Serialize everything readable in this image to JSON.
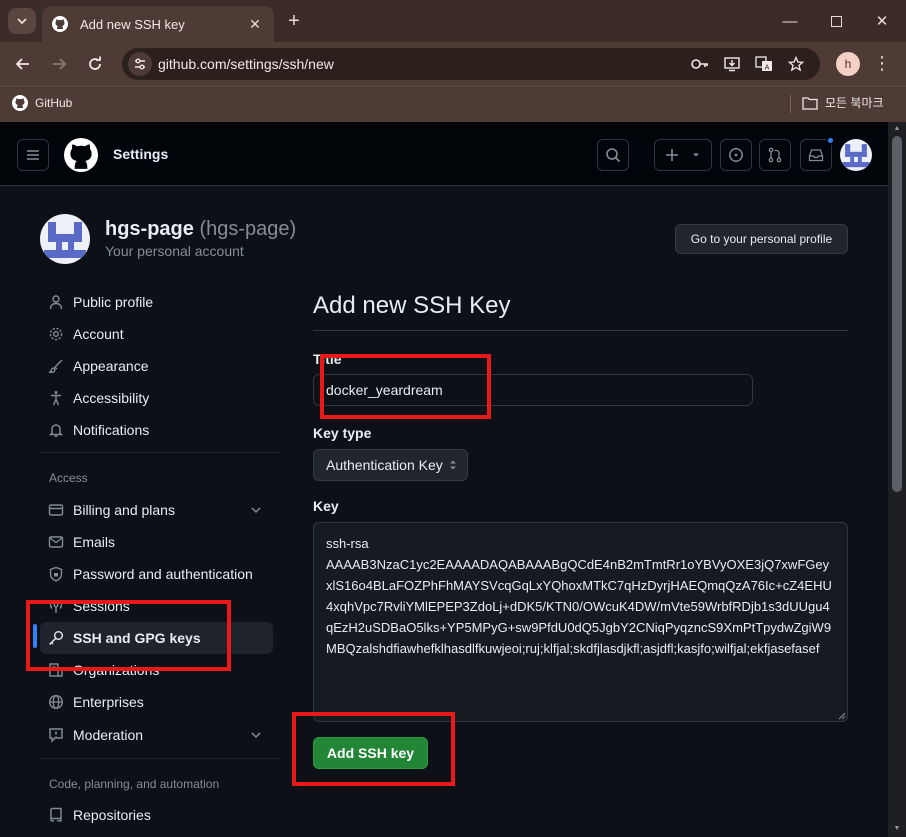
{
  "browser": {
    "tab_title": "Add new SSH key",
    "url": "github.com/settings/ssh/new",
    "profile_initial": "h",
    "bookmark_label": "GitHub",
    "bookmark_folder": "모든 북마크"
  },
  "header": {
    "title": "Settings"
  },
  "user": {
    "name": "hgs-page",
    "login": "(hgs-page)",
    "subtitle": "Your personal account",
    "profile_button": "Go to your personal profile"
  },
  "sidebar": {
    "items": [
      {
        "label": "Public profile",
        "icon": "person-icon"
      },
      {
        "label": "Account",
        "icon": "gear-icon"
      },
      {
        "label": "Appearance",
        "icon": "paintbrush-icon"
      },
      {
        "label": "Accessibility",
        "icon": "accessibility-icon"
      },
      {
        "label": "Notifications",
        "icon": "bell-icon"
      }
    ],
    "group_access": "Access",
    "access_items": [
      {
        "label": "Billing and plans",
        "icon": "credit-card-icon"
      },
      {
        "label": "Emails",
        "icon": "mail-icon"
      },
      {
        "label": "Password and authentication",
        "icon": "shield-lock-icon"
      },
      {
        "label": "Sessions",
        "icon": "broadcast-icon"
      },
      {
        "label": "SSH and GPG keys",
        "icon": "key-icon"
      },
      {
        "label": "Organizations",
        "icon": "organization-icon"
      },
      {
        "label": "Enterprises",
        "icon": "globe-icon"
      },
      {
        "label": "Moderation",
        "icon": "report-icon"
      }
    ],
    "group_code": "Code, planning, and automation",
    "code_items": [
      {
        "label": "Repositories",
        "icon": "repo-icon"
      }
    ]
  },
  "form": {
    "heading": "Add new SSH Key",
    "title_label": "Title",
    "title_value": "docker_yeardream",
    "key_type_label": "Key type",
    "key_type_value": "Authentication Key",
    "key_label": "Key",
    "key_value": "ssh-rsa\nAAAAB3NzaC1yc2EAAAADAQABAAABgQCdE4nB2mTmtRr1oYBVyOXE3jQ7xwFGeyxlS16o4BLaFOZPhFhMAYSVcqGqLxYQhoxMTkC7qHzDyrjHAEQmqQzA76Ic+cZ4EHU4xqhVpc7RvliYMlEPEP3ZdoLj+dDK5/KTN0/OWcuK4DW/mVte59WrbfRDjb1s3dUUgu4qEzH2uSDBaO5lks+YP5MPyG+sw9PfdU0dQ5JgbY2CNiqPyqzncS9XmPtTpydwZgiW9MBQzalshdfiawhefklhasdlfkuwjeoi;ruj;klfjal;skdfjlasdjkfl;asjdfl;kasjfo;wilfjal;ekfjasefasef",
    "submit_label": "Add SSH key"
  },
  "colors": {
    "accent_green": "#238636",
    "highlight_red": "#e81919",
    "active_bar": "#2f81f7"
  }
}
